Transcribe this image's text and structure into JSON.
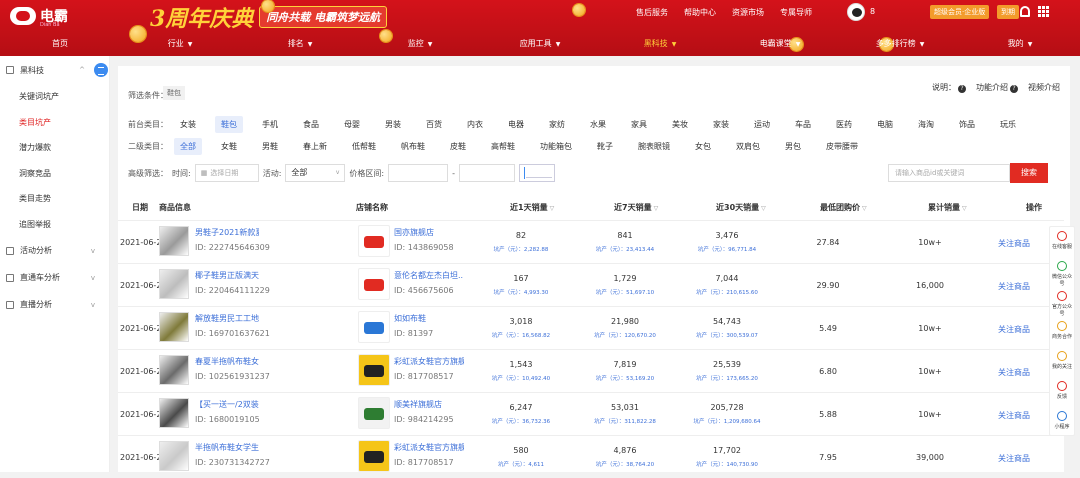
{
  "header": {
    "brand": "电霸",
    "brand_sub": "Dian Ba",
    "anniv_big": "3周年庆典",
    "anniv_sub": "同舟共载 电霸筑梦远航",
    "links": [
      "售后服务",
      "帮助中心",
      "资源市场",
      "专属导师"
    ],
    "user": "8",
    "badge1": "超级会员·企业版",
    "badge2": "到期",
    "colors": {
      "brand": "#d4121a",
      "accent": "#ffd23a"
    }
  },
  "nav": [
    {
      "label": "首页",
      "caret": false
    },
    {
      "label": "行业",
      "caret": true
    },
    {
      "label": "排名",
      "caret": true
    },
    {
      "label": "监控",
      "caret": true
    },
    {
      "label": "应用工具",
      "caret": true
    },
    {
      "label": "黑科技",
      "caret": true,
      "active": true
    },
    {
      "label": "电霸课堂",
      "caret": true
    },
    {
      "label": "多多排行榜",
      "caret": true
    },
    {
      "label": "我的",
      "caret": true
    }
  ],
  "sidebar": {
    "head": "黑科技",
    "items": [
      "关键词坑产",
      "类目坑产",
      "潜力爆款",
      "洞察竞品",
      "类目走势",
      "追图举报"
    ],
    "active_index": 1,
    "groups": [
      "活动分析",
      "直通车分析",
      "直播分析"
    ]
  },
  "filter": {
    "cond_label": "筛选条件：",
    "cond_tag": "鞋包",
    "help": [
      "说明：",
      "功能介绍",
      "视频介绍"
    ],
    "cat1_label": "前台类目：",
    "cat1": [
      "女装",
      "鞋包",
      "手机",
      "食品",
      "母婴",
      "男装",
      "百货",
      "内衣",
      "电器",
      "家纺",
      "水果",
      "家具",
      "美妆",
      "家装",
      "运动",
      "车品",
      "医药",
      "电脑",
      "海淘",
      "饰品",
      "玩乐"
    ],
    "cat1_selected": 1,
    "cat2_label": "二级类目：",
    "cat2": [
      "全部",
      "女鞋",
      "男鞋",
      "春上新",
      "低帮鞋",
      "帆布鞋",
      "皮鞋",
      "高帮鞋",
      "功能箱包",
      "靴子",
      "腕表眼镜",
      "女包",
      "双肩包",
      "男包",
      "皮带腰带"
    ],
    "cat2_selected": 0,
    "adv_label": "高级筛选：",
    "time_label": "时间:",
    "date_placeholder": "选择日期",
    "activity_label": "活动:",
    "activity_value": "全部",
    "price_label": "价格区间:",
    "price_sep": "-",
    "search_placeholder": "请输入商品id或关键词",
    "search_button": "搜索"
  },
  "table": {
    "headers": {
      "date": "日期",
      "product": "商品信息",
      "shop": "店铺名称",
      "d1": "近1天销量",
      "d7": "近7天销量",
      "d30": "近30天销量",
      "price": "最低团购价",
      "total": "累计销量",
      "op": "操作"
    },
    "sub_label": "坑产（元）：",
    "op_label": "关注商品",
    "rows": [
      {
        "date": "2021-06-22",
        "title": "男鞋子2021新款夏...",
        "pid": "ID: 222745646309",
        "shop": "国亦旗舰店",
        "sid": "ID: 143869058",
        "d1": "82",
        "d1s": "2,282.88",
        "d7": "841",
        "d7s": "23,413.44",
        "d30": "3,476",
        "d30s": "96,771.84",
        "price": "27.84",
        "total": "10w+"
      },
      {
        "date": "2021-06-22",
        "title": "椰子鞋男正版满天...",
        "pid": "ID: 220464111229",
        "shop": "意伦名都左杰白坦...",
        "sid": "ID: 456675606",
        "d1": "167",
        "d1s": "4,993.30",
        "d7": "1,729",
        "d7s": "51,697.10",
        "d30": "7,044",
        "d30s": "210,615.60",
        "price": "29.90",
        "total": "16,000"
      },
      {
        "date": "2021-06-22",
        "title": "解放鞋男民工工地...",
        "pid": "ID: 169701637621",
        "shop": "如如布鞋",
        "sid": "ID: 81397",
        "d1": "3,018",
        "d1s": "16,568.82",
        "d7": "21,980",
        "d7s": "120,670.20",
        "d30": "54,743",
        "d30s": "300,539.07",
        "price": "5.49",
        "total": "10w+"
      },
      {
        "date": "2021-06-22",
        "title": "春夏半拖帆布鞋女...",
        "pid": "ID: 102561931237",
        "shop": "彩虹派女鞋官方旗舰店",
        "sid": "ID: 817708517",
        "d1": "1,543",
        "d1s": "10,492.40",
        "d7": "7,819",
        "d7s": "53,169.20",
        "d30": "25,539",
        "d30s": "173,665.20",
        "price": "6.80",
        "total": "10w+"
      },
      {
        "date": "2021-06-22",
        "title": "【买一送一/2双装老...",
        "pid": "ID: 1680019105",
        "shop": "顺美祥旗舰店",
        "sid": "ID: 984214295",
        "d1": "6,247",
        "d1s": "36,732.36",
        "d7": "53,031",
        "d7s": "311,822.28",
        "d30": "205,728",
        "d30s": "1,209,680.64",
        "price": "5.88",
        "total": "10w+"
      },
      {
        "date": "2021-06-22",
        "title": "半拖帆布鞋女学生...",
        "pid": "ID: 230731342727",
        "shop": "彩虹派女鞋官方旗舰店",
        "sid": "ID: 817708517",
        "d1": "580",
        "d1s": "4,611",
        "d7": "4,876",
        "d7s": "38,764.20",
        "d30": "17,702",
        "d30s": "140,730.90",
        "price": "7.95",
        "total": "39,000"
      }
    ]
  },
  "rightbar": [
    "在线客服",
    "微信公众号",
    "官方公众号",
    "商务合作",
    "我的关注",
    "反馈",
    "小程序"
  ]
}
